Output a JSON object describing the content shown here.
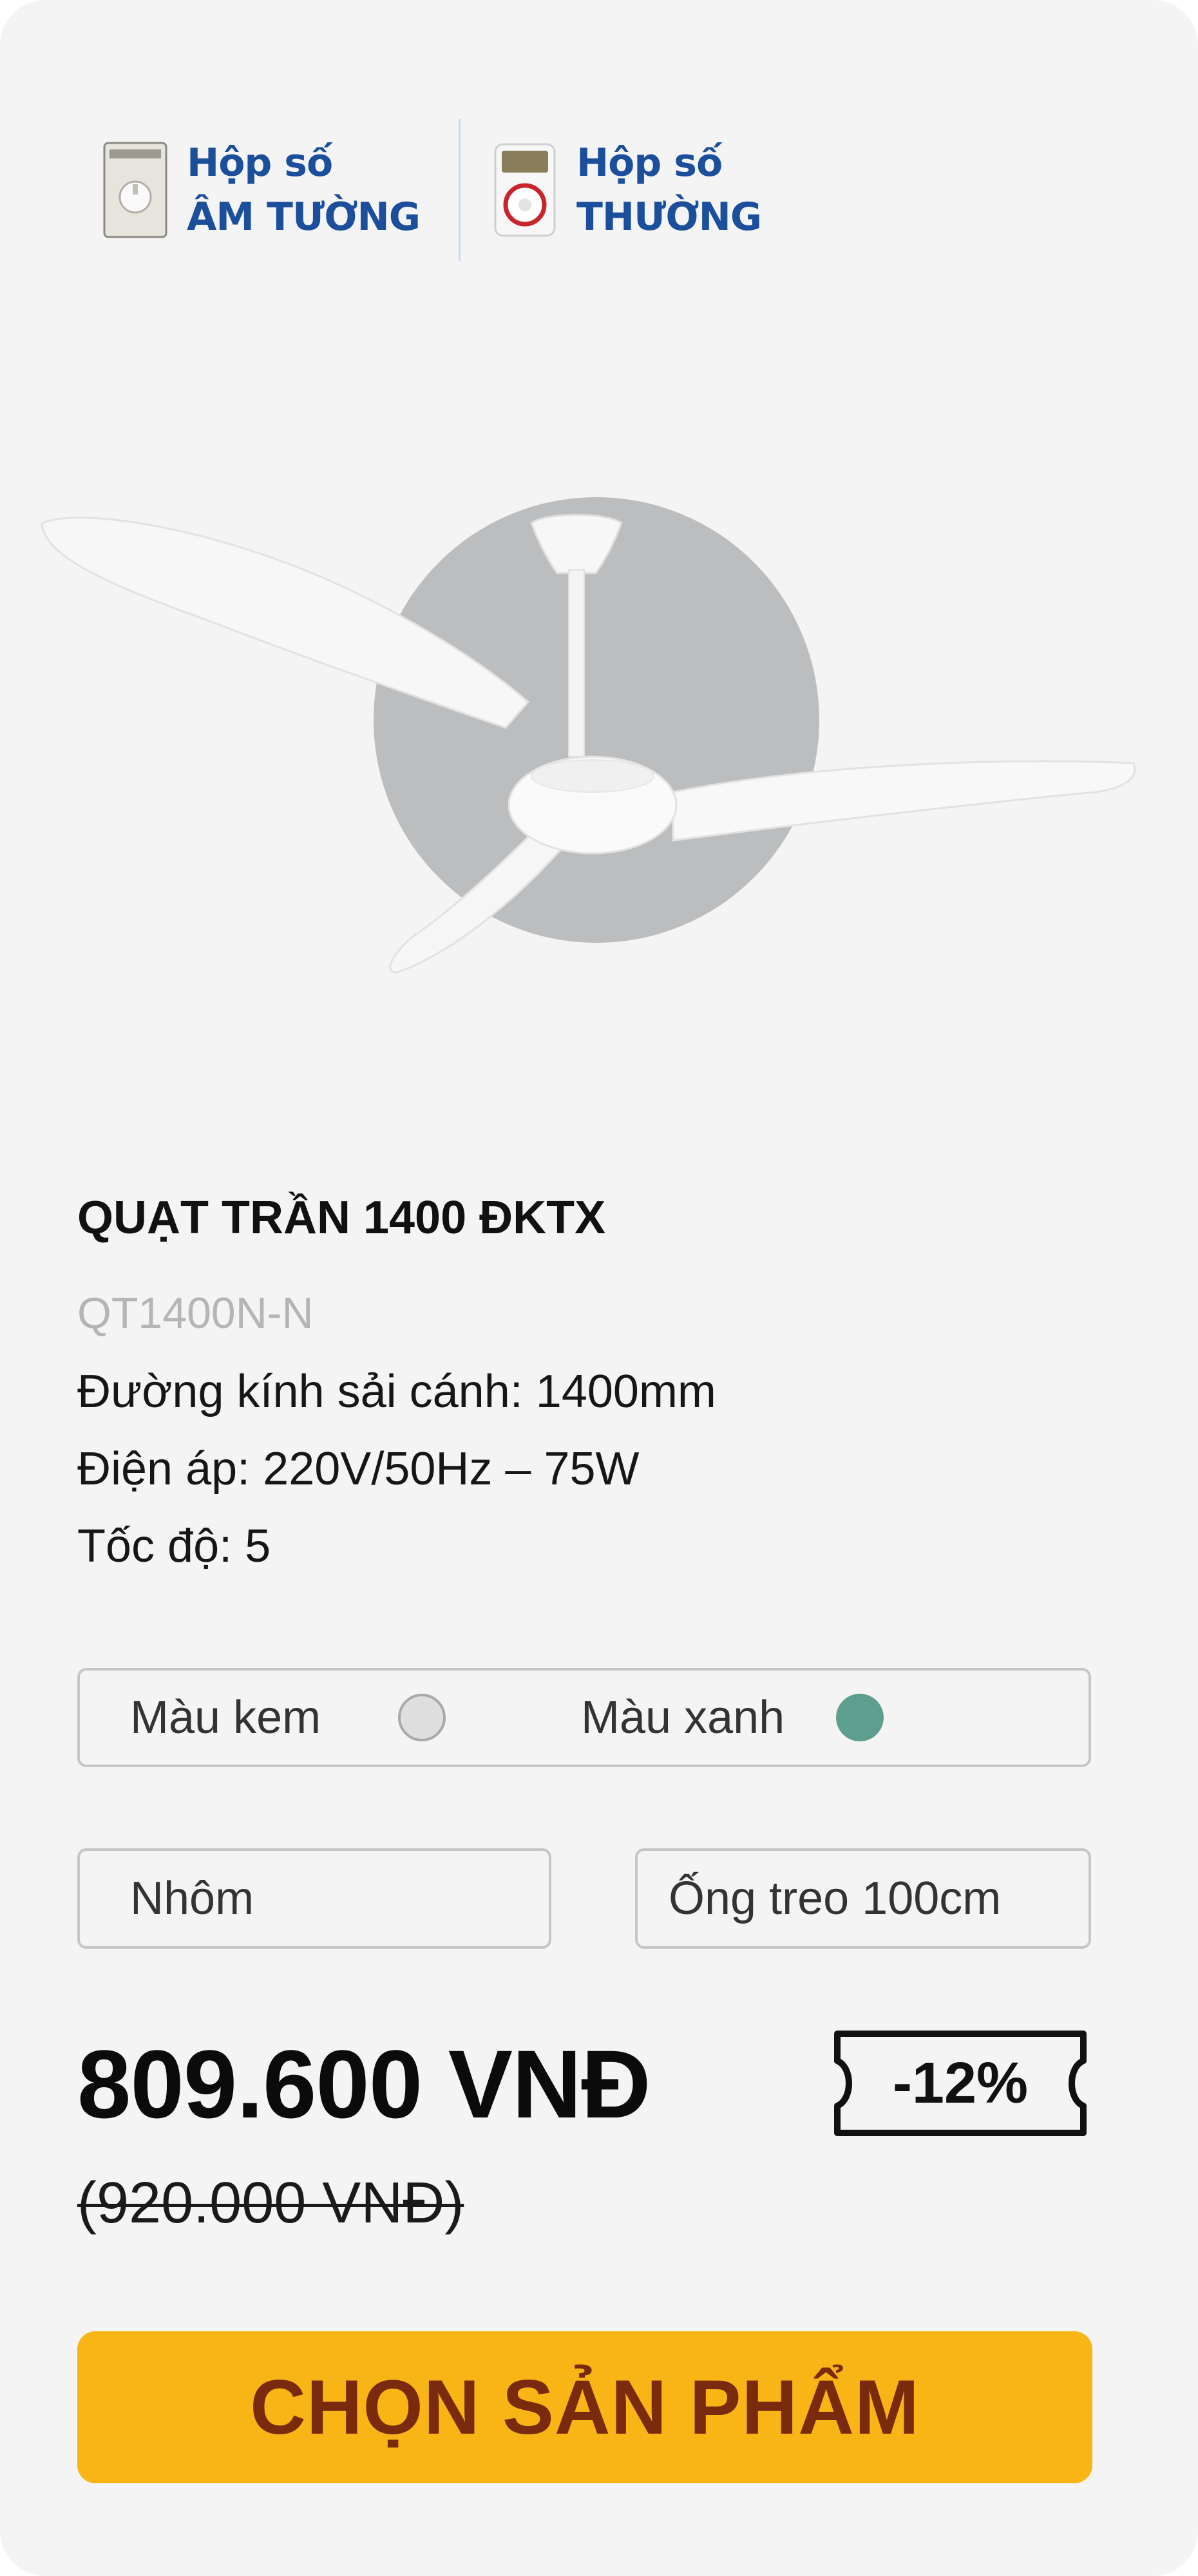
{
  "gearbox_tabs": [
    {
      "line1": "Hộp số",
      "line2": "ÂM TƯỜNG",
      "icon": "wall-gearbox-icon"
    },
    {
      "line1": "Hộp số",
      "line2": "THƯỜNG",
      "icon": "standard-gearbox-icon"
    }
  ],
  "product": {
    "title": "QUẠT TRẦN 1400 ĐKTX",
    "sku": "QT1400N-N",
    "specs": [
      "Đường kính sải cánh: 1400mm",
      "Điện áp: 220V/50Hz – 75W",
      "Tốc độ: 5"
    ]
  },
  "colors": [
    {
      "label": "Màu kem",
      "swatch": "#dedede"
    },
    {
      "label": "Màu xanh",
      "swatch": "#5e9e8e"
    }
  ],
  "options": {
    "material": "Nhôm",
    "tube": "Ống treo 100cm"
  },
  "pricing": {
    "price": "809.600 VNĐ",
    "discount": "-12%",
    "old_price": "(920.000 VNĐ)"
  },
  "cta_label": "CHỌN SẢN PHẨM",
  "theme": {
    "accent": "#f9b515",
    "cta_text": "#7a2b0e",
    "tab_text": "#1b4e9b"
  }
}
